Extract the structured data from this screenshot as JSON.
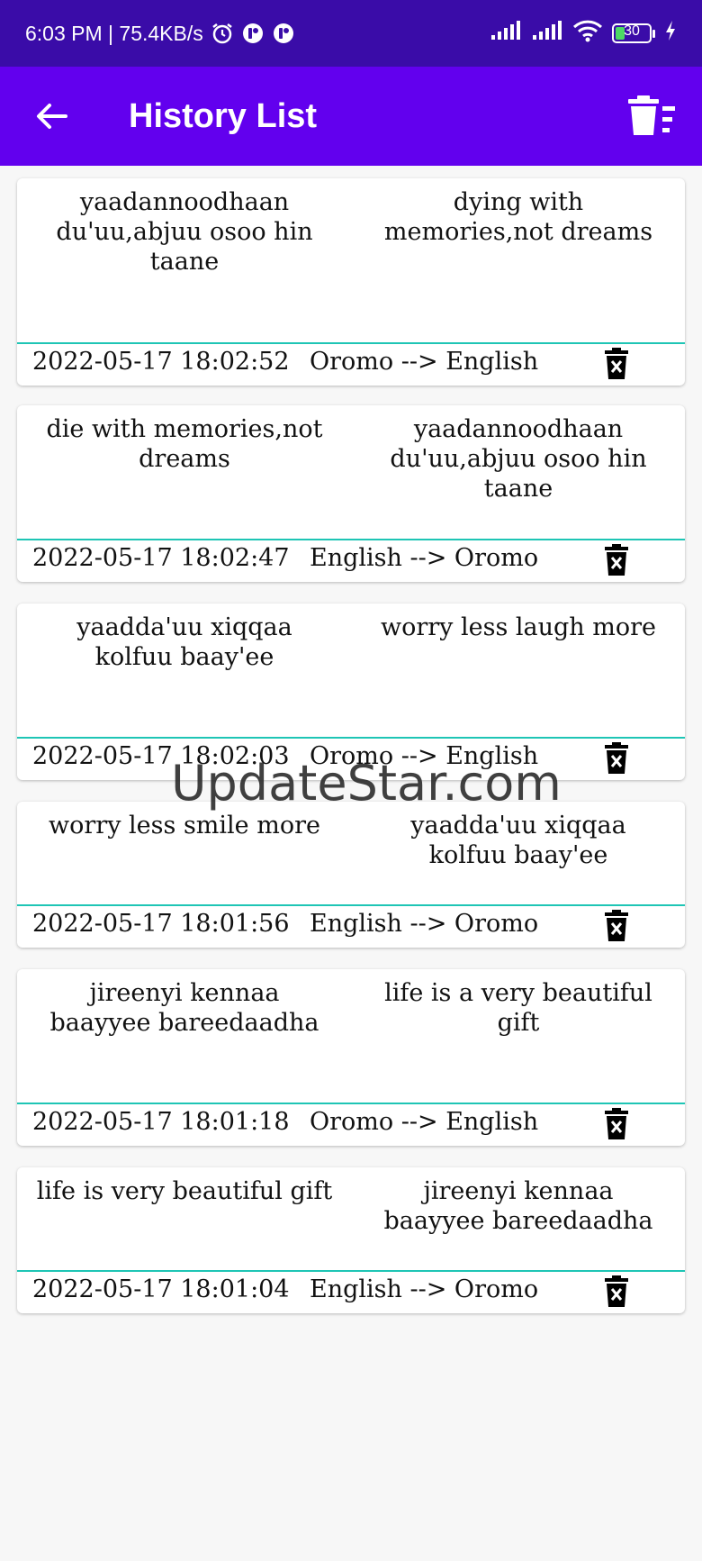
{
  "status_bar": {
    "time_info": "6:03 PM | 75.4KB/s",
    "battery": "30"
  },
  "app_bar": {
    "title": "History List"
  },
  "history": [
    {
      "source": "yaadannoodhaan du'uu,abjuu osoo hin taane",
      "target": "dying with memories,not dreams",
      "timestamp": "2022-05-17 18:02:52",
      "direction": "Oromo --> English"
    },
    {
      "source": "die with memories,not dreams",
      "target": "yaadannoodhaan du'uu,abjuu osoo hin taane",
      "timestamp": "2022-05-17 18:02:47",
      "direction": "English --> Oromo"
    },
    {
      "source": "yaadda'uu xiqqaa kolfuu baay'ee",
      "target": "worry less laugh more",
      "timestamp": "2022-05-17 18:02:03",
      "direction": "Oromo --> English"
    },
    {
      "source": "worry less smile more",
      "target": "yaadda'uu xiqqaa kolfuu baay'ee",
      "timestamp": "2022-05-17 18:01:56",
      "direction": "English --> Oromo"
    },
    {
      "source": "jireenyi kennaa baayyee bareedaadha",
      "target": "life is a very beautiful gift",
      "timestamp": "2022-05-17 18:01:18",
      "direction": "Oromo --> English"
    },
    {
      "source": "life is very beautiful gift",
      "target": "jireenyi kennaa baayyee bareedaadha",
      "timestamp": "2022-05-17 18:01:04",
      "direction": "English --> Oromo"
    }
  ],
  "watermark": "UpdateStar.com"
}
